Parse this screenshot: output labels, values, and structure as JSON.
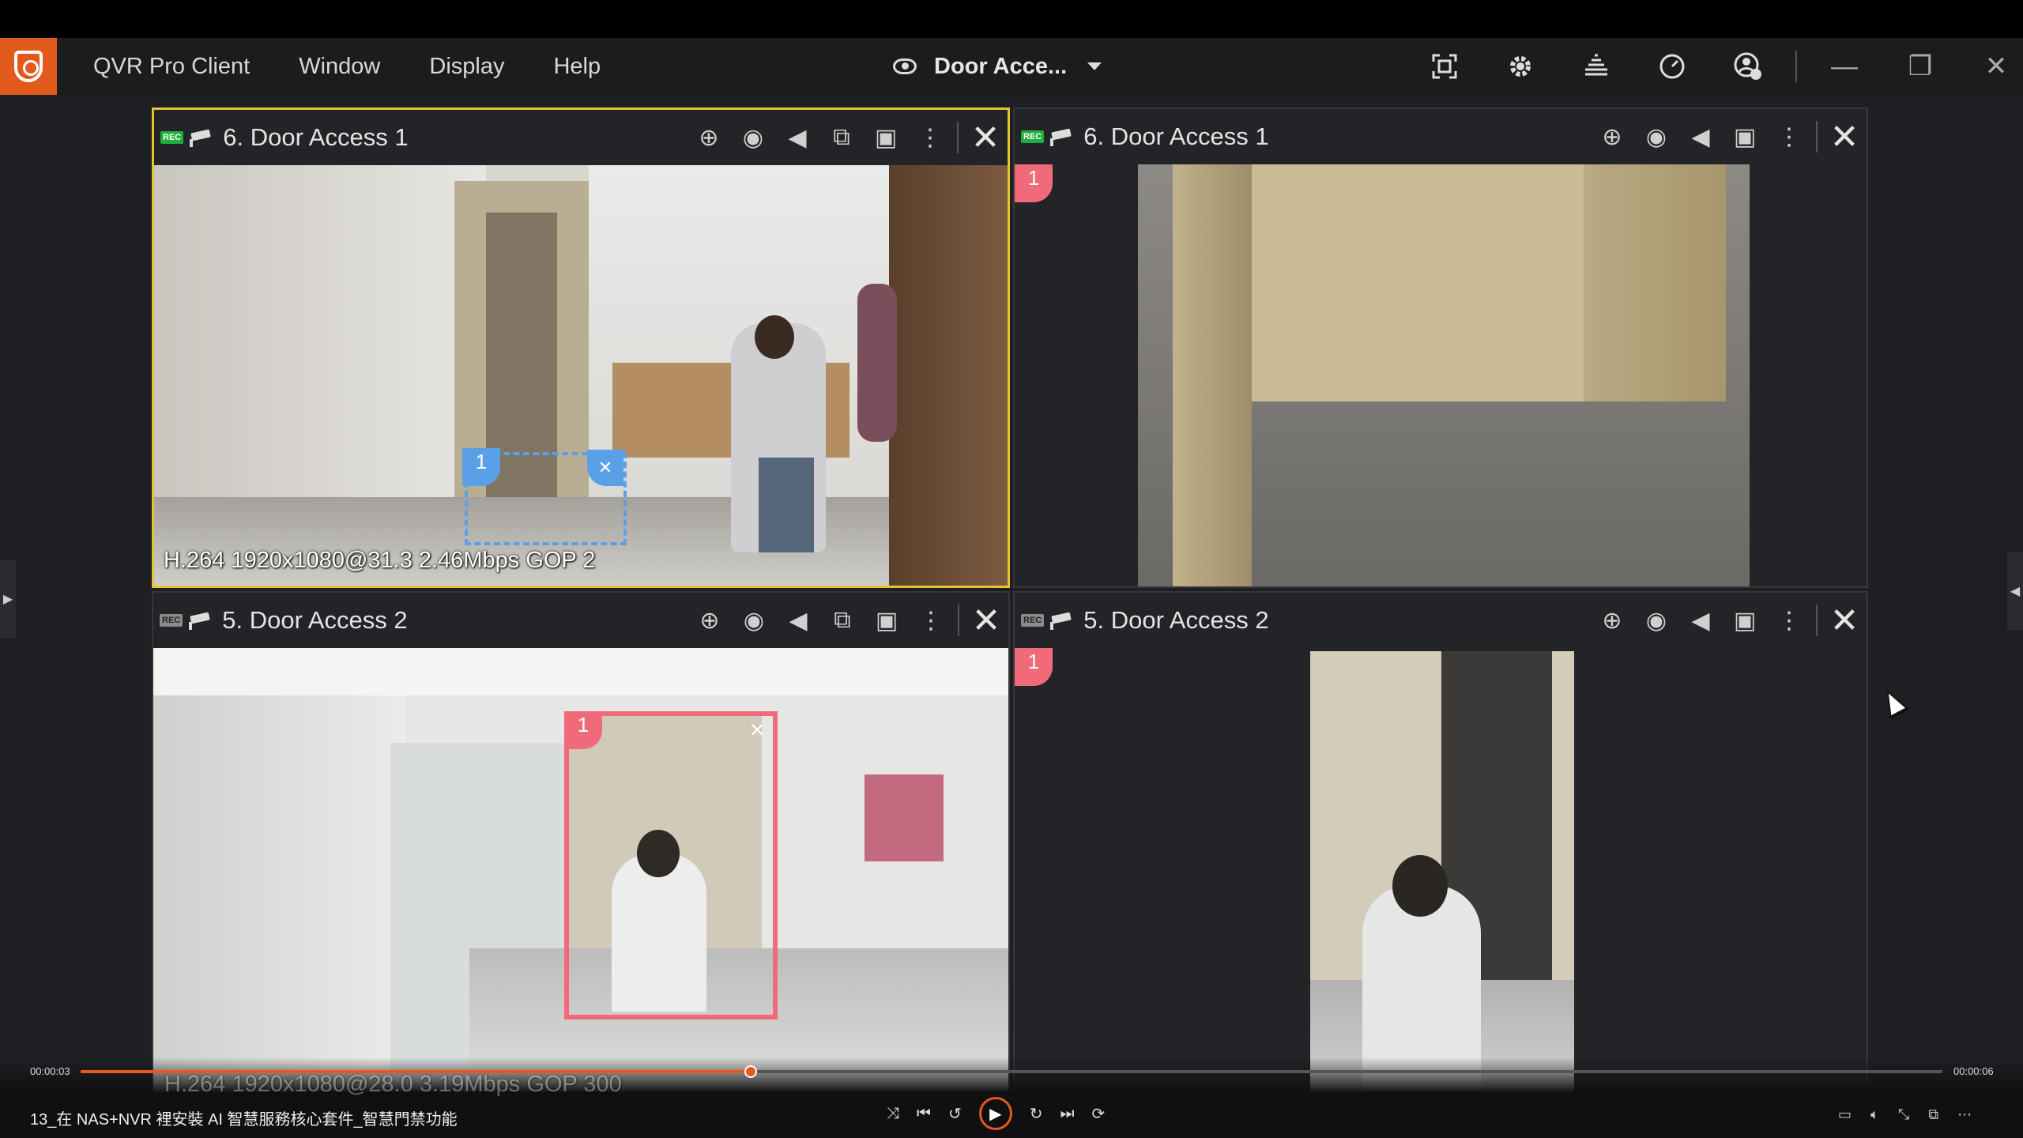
{
  "app": {
    "menu": [
      "QVR Pro Client",
      "Window",
      "Display",
      "Help"
    ],
    "view_name": "Door Acce...",
    "title_tools": [
      "fullscreen-icon",
      "gear-icon",
      "stack-icon",
      "gauge-icon",
      "user-settings-icon"
    ],
    "window_controls": [
      "minimize-icon",
      "restore-icon",
      "close-icon"
    ],
    "accent": "#e25a1c"
  },
  "tiles": [
    {
      "title": "6. Door Access 1",
      "rec": "REC",
      "osd": "H.264 1920x1080@31.3 2.46Mbps GOP 2",
      "roi": "1",
      "active": true
    },
    {
      "title": "6. Door Access 1",
      "rec": "REC",
      "roi": "1",
      "active": false
    },
    {
      "title": "5. Door Access 2",
      "rec": "REC",
      "roi": "1",
      "active": false
    },
    {
      "title": "5. Door Access 2",
      "rec": "REC",
      "roi": "1",
      "active": false
    }
  ],
  "player": {
    "time_current": "00:00:03",
    "time_total": "00:00:06",
    "progress": 0.36,
    "video_title": "13_在 NAS+NVR 裡安裝 AI 智慧服務核心套件_智慧門禁功能",
    "osd_bottom": "H.264 1920x1080@28.0 3.19Mbps GOP 300"
  }
}
